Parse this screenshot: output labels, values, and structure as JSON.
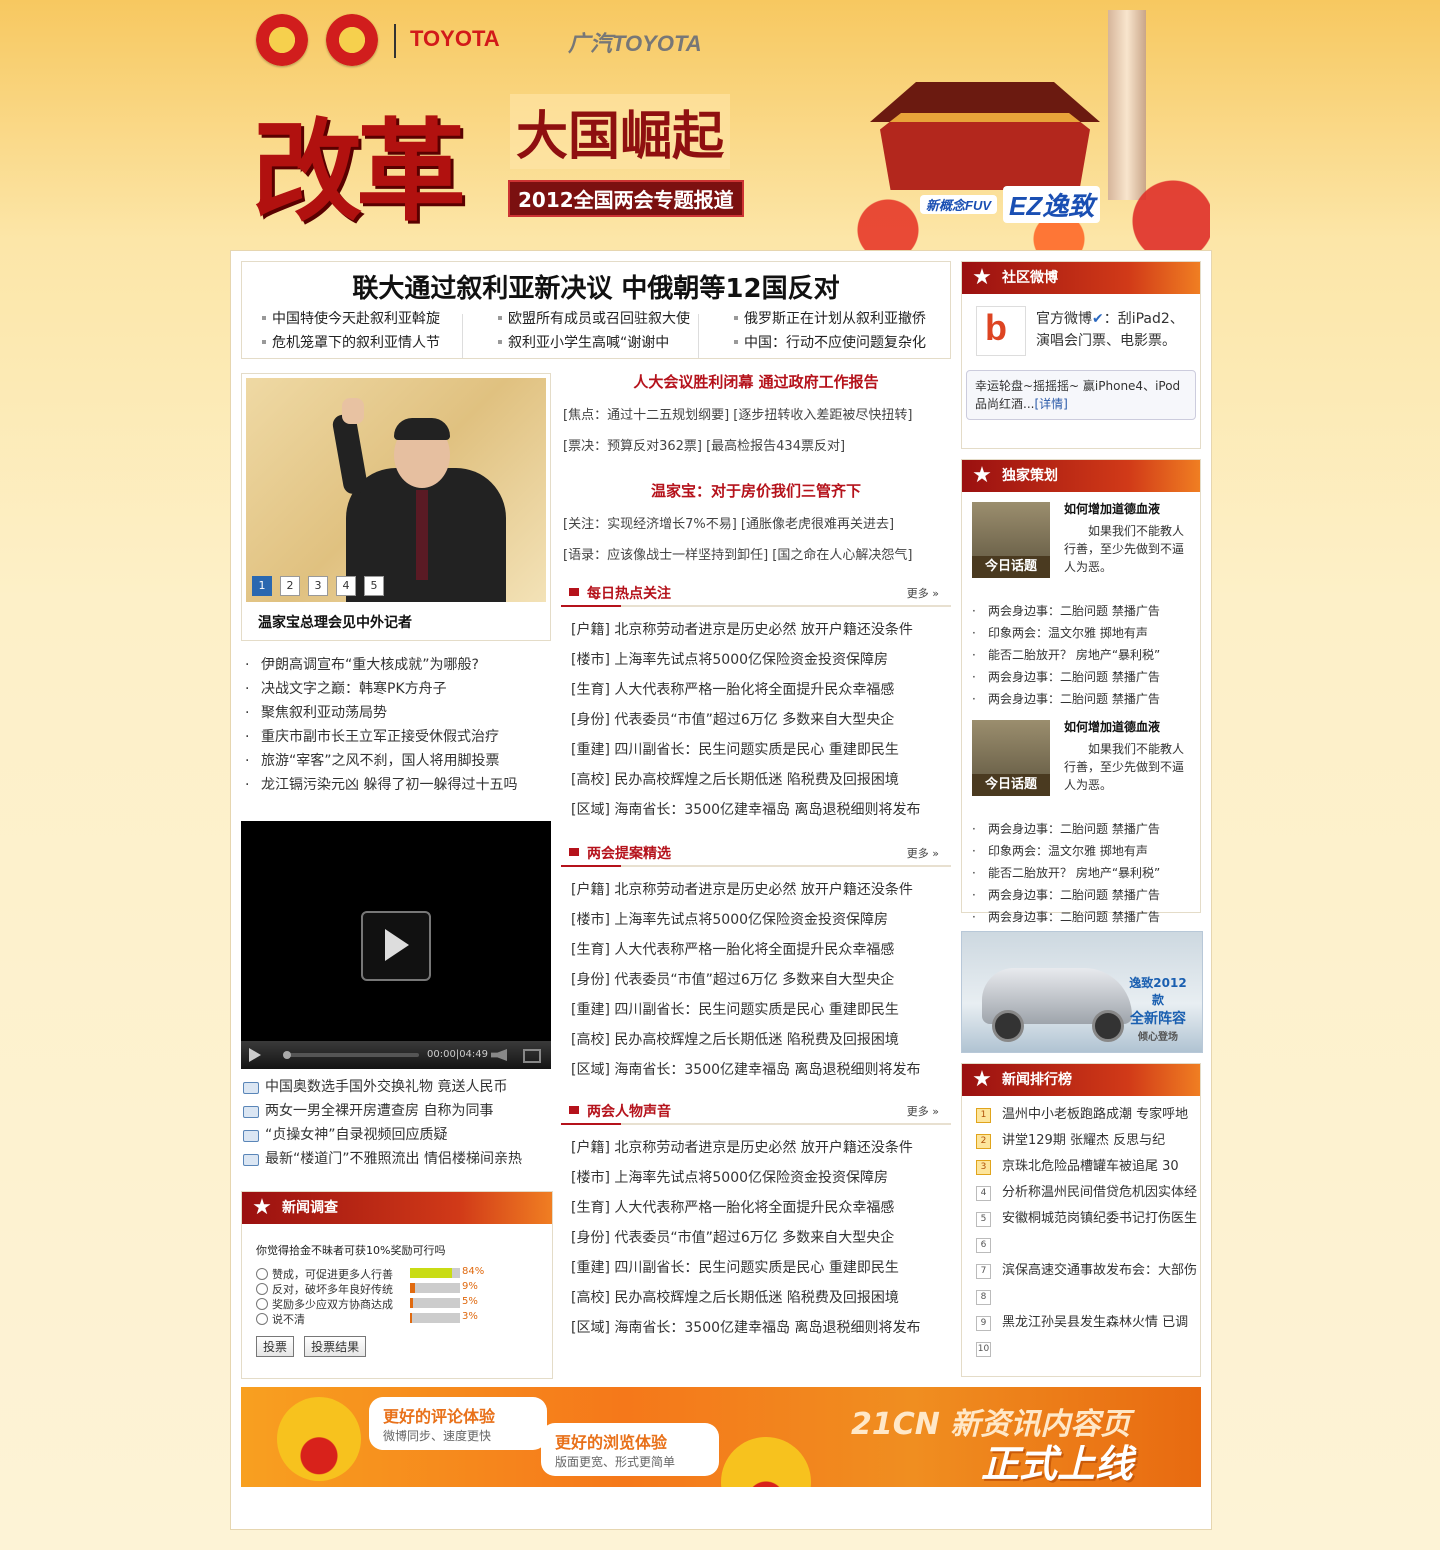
{
  "header": {
    "brand1": "TOYOTA",
    "brand2": "广汽TOYOTA",
    "title_main": "改革",
    "title_sub": "大国崛起",
    "title_tag": "2012全国两会专题报道",
    "ez_fuv": "新概念FUV",
    "ez_brand": "EZ逸致"
  },
  "headline": {
    "title": "联大通过叙利亚新决议 中俄朝等12国反对",
    "row1": [
      "中国特使今天赴叙利亚斡旋",
      "欧盟所有成员或召回驻叙大使",
      "俄罗斯正在计划从叙利亚撤侨"
    ],
    "row2": [
      "危机笼罩下的叙利亚情人节",
      "叙利亚小学生高喊“谢谢中",
      "中国：行动不应使问题复杂化"
    ]
  },
  "slideshow": {
    "pages": [
      "1",
      "2",
      "3",
      "4",
      "5"
    ],
    "caption": "温家宝总理会见中外记者"
  },
  "left_list": [
    "伊朗高调宣布“重大核成就”为哪般?",
    "决战文字之巅：韩寒PK方舟子",
    "聚焦叙利亚动荡局势",
    "重庆市副市长王立军正接受休假式治疗",
    "旅游“宰客”之风不刹，国人将用脚投票",
    "龙江镉污染元凶 躲得了初一躲得过十五吗"
  ],
  "video": {
    "time": "00:00|04:49"
  },
  "video_list": [
    "中国奥数选手国外交换礼物 竟送人民币",
    "两女一男全裸开房遭查房 自称为同事",
    "“贞操女神”自录视频回应质疑",
    "最新“楼道门”不雅照流出 情侣楼梯间亲热"
  ],
  "survey": {
    "title": "新闻调查",
    "question": "你觉得拾金不昧者可获10%奖励可行吗",
    "options": [
      {
        "label": "赞成，可促进更多人行善",
        "pct": "84%",
        "value": 84,
        "color": "#c9dc14"
      },
      {
        "label": "反对，破坏多年良好传统",
        "pct": "9%",
        "value": 9,
        "color": "#e06a10"
      },
      {
        "label": "奖励多少应双方协商达成",
        "pct": "5%",
        "value": 5,
        "color": "#e06a10"
      },
      {
        "label": "说不清",
        "pct": "3%",
        "value": 3,
        "color": "#e06a10"
      }
    ],
    "vote_btn": "投票",
    "result_btn": "投票结果"
  },
  "middle": {
    "top1": {
      "title": "人大会议胜利闭幕 通过政府工作报告",
      "lines": [
        "[焦点：通过十二五规划纲要] [逐步扭转收入差距被尽快扭转]",
        "[票决：预算反对362票] [最高检报告434票反对]"
      ]
    },
    "top2": {
      "title": "温家宝：对于房价我们三管齐下",
      "lines": [
        "[关注：实现经济增长7%不易] [通胀像老虎很难再关进去]",
        "[语录：应该像战士一样坚持到卸任] [国之命在人心解决怨气]"
      ]
    },
    "more": "更多 »",
    "sections": [
      {
        "title": "每日热点关注"
      },
      {
        "title": "两会提案精选"
      },
      {
        "title": "两会人物声音"
      }
    ],
    "rows": [
      "[户籍] 北京称劳动者进京是历史必然 放开户籍还没条件",
      "[楼市] 上海率先试点将5000亿保险资金投资保障房",
      "[生育] 人大代表称严格一胎化将全面提升民众幸福感",
      "[身份] 代表委员“市值”超过6万亿 多数来自大型央企",
      "[重建] 四川副省长：民生问题实质是民心 重建即民生",
      "[高校] 民办高校辉煌之后长期低迷 陷税费及回报困境",
      "[区域] 海南省长：3500亿建幸福岛 离岛退税细则将发布"
    ]
  },
  "weibo": {
    "title": "社区微博",
    "account": "官方微博",
    "text": "：刮iPad2、演唱会门票、电影票。",
    "card": "幸运轮盘~摇摇摇~ 赢iPhone4、iPod品尚红酒...",
    "detail": "[详情]"
  },
  "exclusive": {
    "title": "独家策划",
    "badge": "今日话题",
    "feat_title": "如何增加道德血液",
    "feat_desc": "如果我们不能教人行善，至少先做到不逼人为恶。",
    "links": [
      "两会身边事：二胎问题 禁播广告",
      "印象两会：温文尔雅 掷地有声",
      "能否二胎放开？ 房地产“暴利税”",
      "两会身边事：二胎问题 禁播广告",
      "两会身边事：二胎问题 禁播广告"
    ]
  },
  "car_ad": {
    "line1": "逸致2012款",
    "line2": "全新阵容",
    "line3": "倾心登场"
  },
  "ranking": {
    "title": "新闻排行榜",
    "items": [
      {
        "n": "1",
        "t": "温州中小老板跑路成潮 专家呼地"
      },
      {
        "n": "2",
        "t": "讲堂129期 张耀杰 反思与纪"
      },
      {
        "n": "3",
        "t": "京珠北危险品槽罐车被追尾 30"
      },
      {
        "n": "4",
        "t": "分析称温州民间借贷危机因实体经"
      },
      {
        "n": "5",
        "t": "安徽桐城范岗镇纪委书记打伤医生"
      },
      {
        "n": "6",
        "t": ""
      },
      {
        "n": "7",
        "t": "滨保高速交通事故发布会：大部伤"
      },
      {
        "n": "8",
        "t": ""
      },
      {
        "n": "9",
        "t": "黑龙江孙吴县发生森林火情 已调"
      },
      {
        "n": "10",
        "t": ""
      }
    ]
  },
  "banner": {
    "b1_title": "更好的评论体验",
    "b1_sub": "微博同步、速度更快",
    "b2_title": "更好的浏览体验",
    "b2_sub": "版面更宽、形式更简单",
    "brand": "21CN 新资讯内容页",
    "launch": "正式上线"
  }
}
